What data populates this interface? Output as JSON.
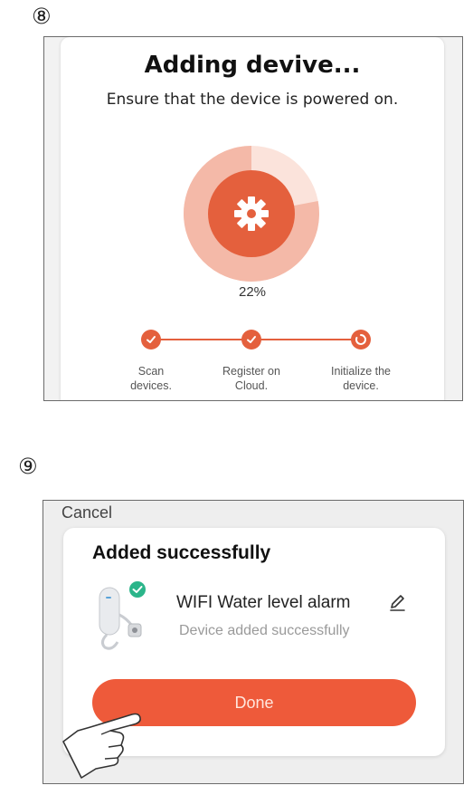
{
  "step8": {
    "number": "⑧",
    "title": "Adding devive...",
    "subtitle": "Ensure that the device is powered on.",
    "progress_text": "22%",
    "progress_value": 0.22,
    "steps": [
      {
        "label_line1": "Scan",
        "label_line2": "devices.",
        "state": "done",
        "icon": "check-icon"
      },
      {
        "label_line1": "Register on",
        "label_line2": "Cloud.",
        "state": "done",
        "icon": "check-icon"
      },
      {
        "label_line1": "Initialize the",
        "label_line2": "device.",
        "state": "in-progress",
        "icon": "spinner-icon"
      }
    ],
    "center_icon": "gear-icon"
  },
  "step9": {
    "number": "⑨",
    "cancel_label": "Cancel",
    "title": "Added successfully",
    "device_name": "WIFI  Water level alarm",
    "device_status": "Device added successfully",
    "done_label": "Done",
    "edit_icon": "pencil-icon",
    "badge_icon": "check-icon"
  },
  "colors": {
    "accent": "#ee5a3a",
    "ring_light": "#f4b9a8",
    "ring_core": "#e4603d",
    "success_badge": "#2bb58a"
  }
}
